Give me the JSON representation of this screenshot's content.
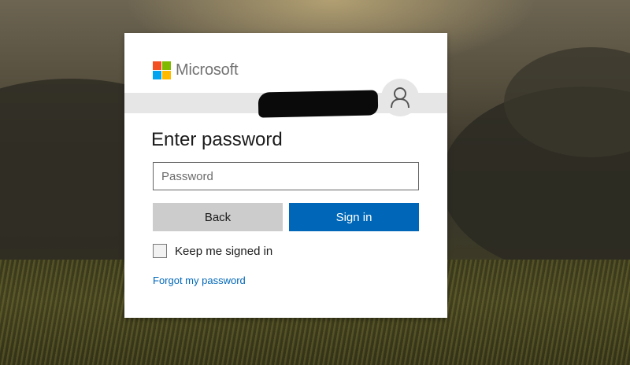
{
  "brand": {
    "name": "Microsoft",
    "logo_colors": [
      "#f25022",
      "#7fba00",
      "#00a4ef",
      "#ffb900"
    ]
  },
  "identity": {
    "account_redacted": true,
    "avatar_icon": "user-icon"
  },
  "form": {
    "title": "Enter password",
    "password_placeholder": "Password",
    "password_value": "",
    "back_label": "Back",
    "signin_label": "Sign in",
    "keep_signed_in_label": "Keep me signed in",
    "keep_signed_in_checked": false,
    "forgot_label": "Forgot my password"
  },
  "colors": {
    "accent": "#0067b8",
    "secondary_button": "#cccccc",
    "text": "#1b1b1b"
  }
}
